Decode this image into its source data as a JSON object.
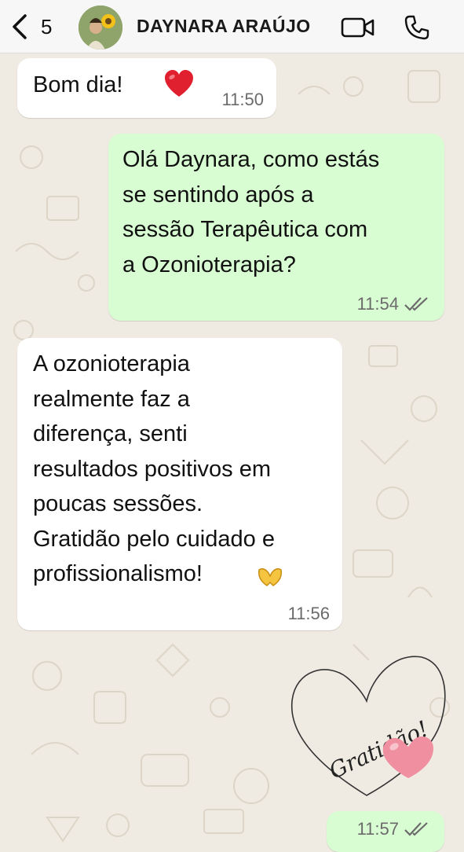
{
  "header": {
    "back_count": "5",
    "contact_name": "DAYNARA ARAÚJO"
  },
  "messages": [
    {
      "direction": "incoming",
      "text": "Bom dia!",
      "emoji": "red-heart",
      "time": "11:50"
    },
    {
      "direction": "outgoing",
      "text": "Olá Daynara, como estás\nse sentindo após a\nsessão Terapêutica com\na Ozonioterapia?",
      "time": "11:54",
      "status": "read"
    },
    {
      "direction": "incoming",
      "text": "A ozonioterapia\nrealmente faz a\ndiferença, senti\nresultados positivos em\npoucas sessões.\nGratidão pelo cuidado e\nprofissionalismo!",
      "emoji": "heart-hands",
      "time": "11:56"
    },
    {
      "direction": "outgoing",
      "type": "sticker",
      "sticker_text": "Gratidão!",
      "time": "11:57",
      "status": "read"
    }
  ],
  "colors": {
    "chat_background": "#efeae2",
    "incoming_bubble": "#ffffff",
    "outgoing_bubble": "#d9fdd3",
    "read_ticks": "#6b6b6b"
  }
}
